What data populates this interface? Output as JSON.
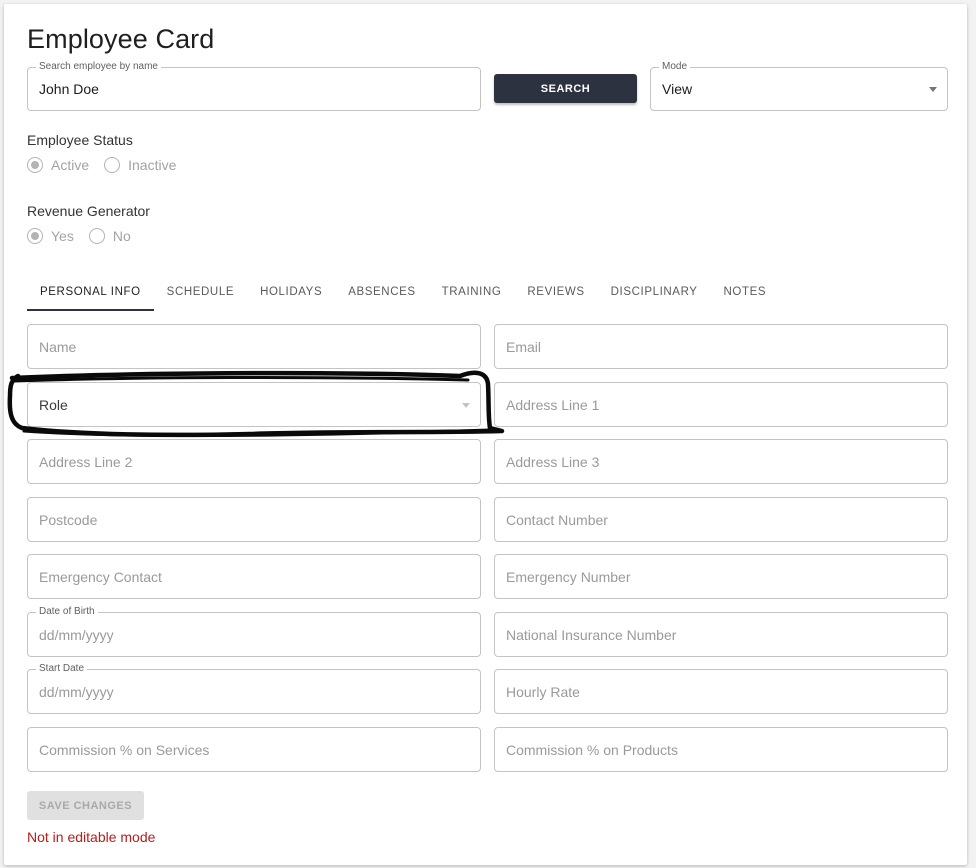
{
  "page": {
    "title": "Employee Card"
  },
  "search": {
    "label": "Search employee by name",
    "value": "John Doe",
    "button_label": "SEARCH"
  },
  "mode": {
    "label": "Mode",
    "value": "View"
  },
  "employee_status": {
    "label": "Employee Status",
    "options": [
      "Active",
      "Inactive"
    ],
    "selected": "Active"
  },
  "revenue_generator": {
    "label": "Revenue Generator",
    "options": [
      "Yes",
      "No"
    ],
    "selected": "Yes"
  },
  "tabs": [
    "PERSONAL INFO",
    "SCHEDULE",
    "HOLIDAYS",
    "ABSENCES",
    "TRAINING",
    "REVIEWS",
    "DISCIPLINARY",
    "NOTES"
  ],
  "active_tab": "PERSONAL INFO",
  "form": {
    "name": "Name",
    "email": "Email",
    "role": "Role",
    "address1": "Address Line 1",
    "address2": "Address Line 2",
    "address3": "Address Line 3",
    "postcode": "Postcode",
    "contact_number": "Contact Number",
    "emergency_contact": "Emergency Contact",
    "emergency_number": "Emergency Number",
    "dob_label": "Date of Birth",
    "dob_placeholder": "dd/mm/yyyy",
    "national_insurance": "National Insurance Number",
    "start_date_label": "Start Date",
    "start_date_placeholder": "dd/mm/yyyy",
    "hourly_rate": "Hourly Rate",
    "commission_services": "Commission % on Services",
    "commission_products": "Commission % on Products"
  },
  "save_button_label": "SAVE CHANGES",
  "error_message": "Not in editable mode",
  "colors": {
    "primary_button": "#2c3240",
    "error": "#b71c1c",
    "disabled_text": "#a3a3a3"
  }
}
